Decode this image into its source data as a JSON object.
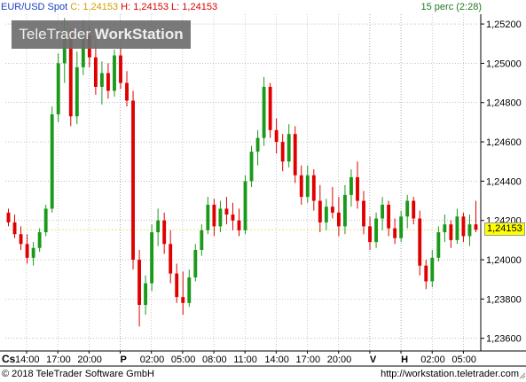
{
  "header": {
    "symbol": "EUR/USD Spot",
    "close_label": "C:",
    "close_value": "1,24153",
    "high_label": "H:",
    "high_value": "1,24153",
    "low_label": "L:",
    "low_value": "1,24153",
    "interval": "15 perc (2:28)"
  },
  "watermark": {
    "light": "TeleTrader",
    "bold": "WorkStation"
  },
  "footer": {
    "copyright": "© 2018 TeleTrader Software GmbH",
    "url": "http://workstation.teletrader.com"
  },
  "x_axis": {
    "corner_label": "Cs",
    "ticks": [
      "14:00",
      "17:00",
      "20:00",
      "P",
      "02:00",
      "05:00",
      "08:00",
      "11:00",
      "14:00",
      "17:00",
      "20:00",
      "V",
      "H",
      "02:00",
      "05:00"
    ],
    "day_markers": [
      "P",
      "V",
      "H"
    ]
  },
  "chart_data": {
    "type": "candlestick",
    "title": "EUR/USD Spot",
    "interval": "15 perc",
    "last_price": 1.24153,
    "ylim": [
      1.2354,
      1.2525
    ],
    "y_ticks": [
      "1,25200",
      "1,25000",
      "1,24800",
      "1,24600",
      "1,24400",
      "1,24200",
      "1,24000",
      "1,23800",
      "1,23600"
    ],
    "grid": true,
    "up_color": "#1a9a1a",
    "down_color": "#e00000",
    "candles": [
      [
        1.2424,
        1.2426,
        1.2417,
        1.2419
      ],
      [
        1.2419,
        1.2423,
        1.2411,
        1.2413
      ],
      [
        1.2413,
        1.2417,
        1.2405,
        1.2408
      ],
      [
        1.2408,
        1.2413,
        1.2398,
        1.2401
      ],
      [
        1.2401,
        1.2409,
        1.2397,
        1.2406
      ],
      [
        1.2406,
        1.2416,
        1.2404,
        1.2414
      ],
      [
        1.2414,
        1.2428,
        1.2412,
        1.2426
      ],
      [
        1.2426,
        1.2478,
        1.2424,
        1.2474
      ],
      [
        1.2474,
        1.2505,
        1.247,
        1.25
      ],
      [
        1.25,
        1.2523,
        1.249,
        1.2514
      ],
      [
        1.2514,
        1.2518,
        1.2468,
        1.2473
      ],
      [
        1.2473,
        1.2506,
        1.2469,
        1.2498
      ],
      [
        1.2498,
        1.2522,
        1.2494,
        1.2514
      ],
      [
        1.2514,
        1.2519,
        1.2498,
        1.2503
      ],
      [
        1.2503,
        1.2511,
        1.2484,
        1.2488
      ],
      [
        1.2488,
        1.2501,
        1.2479,
        1.2495
      ],
      [
        1.2495,
        1.25,
        1.2482,
        1.2486
      ],
      [
        1.2486,
        1.2507,
        1.2483,
        1.2504
      ],
      [
        1.2504,
        1.2508,
        1.2487,
        1.249
      ],
      [
        1.249,
        1.2496,
        1.2478,
        1.2481
      ],
      [
        1.2481,
        1.2486,
        1.2395,
        1.24
      ],
      [
        1.24,
        1.2405,
        1.2366,
        1.2377
      ],
      [
        1.2377,
        1.2392,
        1.2372,
        1.2388
      ],
      [
        1.2388,
        1.2418,
        1.2384,
        1.2414
      ],
      [
        1.2414,
        1.2426,
        1.2407,
        1.242
      ],
      [
        1.242,
        1.2424,
        1.2403,
        1.2408
      ],
      [
        1.2408,
        1.2415,
        1.2388,
        1.2393
      ],
      [
        1.2393,
        1.2398,
        1.2378,
        1.2381
      ],
      [
        1.2381,
        1.2394,
        1.2372,
        1.2378
      ],
      [
        1.2378,
        1.2395,
        1.2376,
        1.2391
      ],
      [
        1.2391,
        1.2408,
        1.2389,
        1.2405
      ],
      [
        1.2405,
        1.2418,
        1.2402,
        1.2415
      ],
      [
        1.2415,
        1.2432,
        1.2413,
        1.2428
      ],
      [
        1.2428,
        1.2431,
        1.2412,
        1.2417
      ],
      [
        1.2417,
        1.243,
        1.2414,
        1.2426
      ],
      [
        1.2426,
        1.2432,
        1.2418,
        1.2423
      ],
      [
        1.2423,
        1.2429,
        1.2415,
        1.242
      ],
      [
        1.242,
        1.2426,
        1.2412,
        1.2415
      ],
      [
        1.2415,
        1.2443,
        1.2413,
        1.244
      ],
      [
        1.244,
        1.2458,
        1.2437,
        1.2455
      ],
      [
        1.2455,
        1.2466,
        1.2448,
        1.2462
      ],
      [
        1.2462,
        1.2493,
        1.2458,
        1.2488
      ],
      [
        1.2488,
        1.249,
        1.2462,
        1.2466
      ],
      [
        1.2466,
        1.2472,
        1.2454,
        1.246
      ],
      [
        1.246,
        1.2464,
        1.2445,
        1.245
      ],
      [
        1.245,
        1.2469,
        1.2447,
        1.2464
      ],
      [
        1.2464,
        1.2468,
        1.2439,
        1.2443
      ],
      [
        1.2443,
        1.2448,
        1.2428,
        1.2432
      ],
      [
        1.2432,
        1.2448,
        1.2429,
        1.2443
      ],
      [
        1.2443,
        1.2446,
        1.2425,
        1.243
      ],
      [
        1.243,
        1.2438,
        1.2414,
        1.2419
      ],
      [
        1.2419,
        1.2431,
        1.2415,
        1.2427
      ],
      [
        1.2427,
        1.2437,
        1.2421,
        1.2424
      ],
      [
        1.2424,
        1.2432,
        1.2412,
        1.2417
      ],
      [
        1.2417,
        1.2438,
        1.2413,
        1.2433
      ],
      [
        1.2433,
        1.2446,
        1.2427,
        1.2442
      ],
      [
        1.2442,
        1.245,
        1.2426,
        1.243
      ],
      [
        1.243,
        1.2435,
        1.2413,
        1.2417
      ],
      [
        1.2417,
        1.2422,
        1.2405,
        1.2409
      ],
      [
        1.2409,
        1.2424,
        1.2406,
        1.2421
      ],
      [
        1.2421,
        1.2432,
        1.2415,
        1.2428
      ],
      [
        1.2428,
        1.243,
        1.2412,
        1.2416
      ],
      [
        1.2416,
        1.2421,
        1.2408,
        1.2411
      ],
      [
        1.2411,
        1.2425,
        1.2409,
        1.2422
      ],
      [
        1.2422,
        1.2433,
        1.2416,
        1.243
      ],
      [
        1.243,
        1.2432,
        1.2418,
        1.2421
      ],
      [
        1.2421,
        1.2425,
        1.2392,
        1.2397
      ],
      [
        1.2397,
        1.24,
        1.2385,
        1.2389
      ],
      [
        1.2389,
        1.2405,
        1.2386,
        1.2401
      ],
      [
        1.2401,
        1.2417,
        1.2399,
        1.2414
      ],
      [
        1.2414,
        1.2423,
        1.2409,
        1.2418
      ],
      [
        1.2418,
        1.242,
        1.2406,
        1.241
      ],
      [
        1.241,
        1.2426,
        1.2408,
        1.2422
      ],
      [
        1.2422,
        1.2424,
        1.2409,
        1.2412
      ],
      [
        1.2412,
        1.2423,
        1.2407,
        1.2418
      ],
      [
        1.2418,
        1.243,
        1.2414,
        1.24153
      ]
    ]
  }
}
